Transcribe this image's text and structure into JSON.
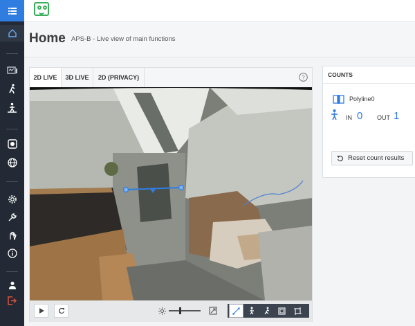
{
  "header": {
    "title": "Home",
    "subtitle": "APS-B - Live view of main functions"
  },
  "tabs": [
    {
      "label": "2D LIVE",
      "active": true
    },
    {
      "label": "3D LIVE",
      "active": false
    },
    {
      "label": "2D (PRIVACY)",
      "active": false
    }
  ],
  "counts": {
    "title": "COUNTS",
    "line_name": "Polyline0",
    "in_label": "IN",
    "in_value": "0",
    "out_label": "OUT",
    "out_value": "1",
    "reset_label": "Reset count results"
  },
  "sidebar": {
    "icons": [
      "menu-icon",
      "home-icon",
      "dashboard-icon",
      "walk-icon",
      "person-count-icon",
      "record-icon",
      "globe-icon",
      "gear-icon",
      "wrench-icon",
      "hand-icon",
      "info-icon",
      "user-icon",
      "logout-icon"
    ]
  },
  "controls": {
    "brightness_level": 0.35,
    "active_tool": "line-tool"
  },
  "colors": {
    "accent": "#2f7de1",
    "sidebar": "#232a35",
    "logo": "#3aae5a",
    "count_value": "#2f7de1"
  }
}
